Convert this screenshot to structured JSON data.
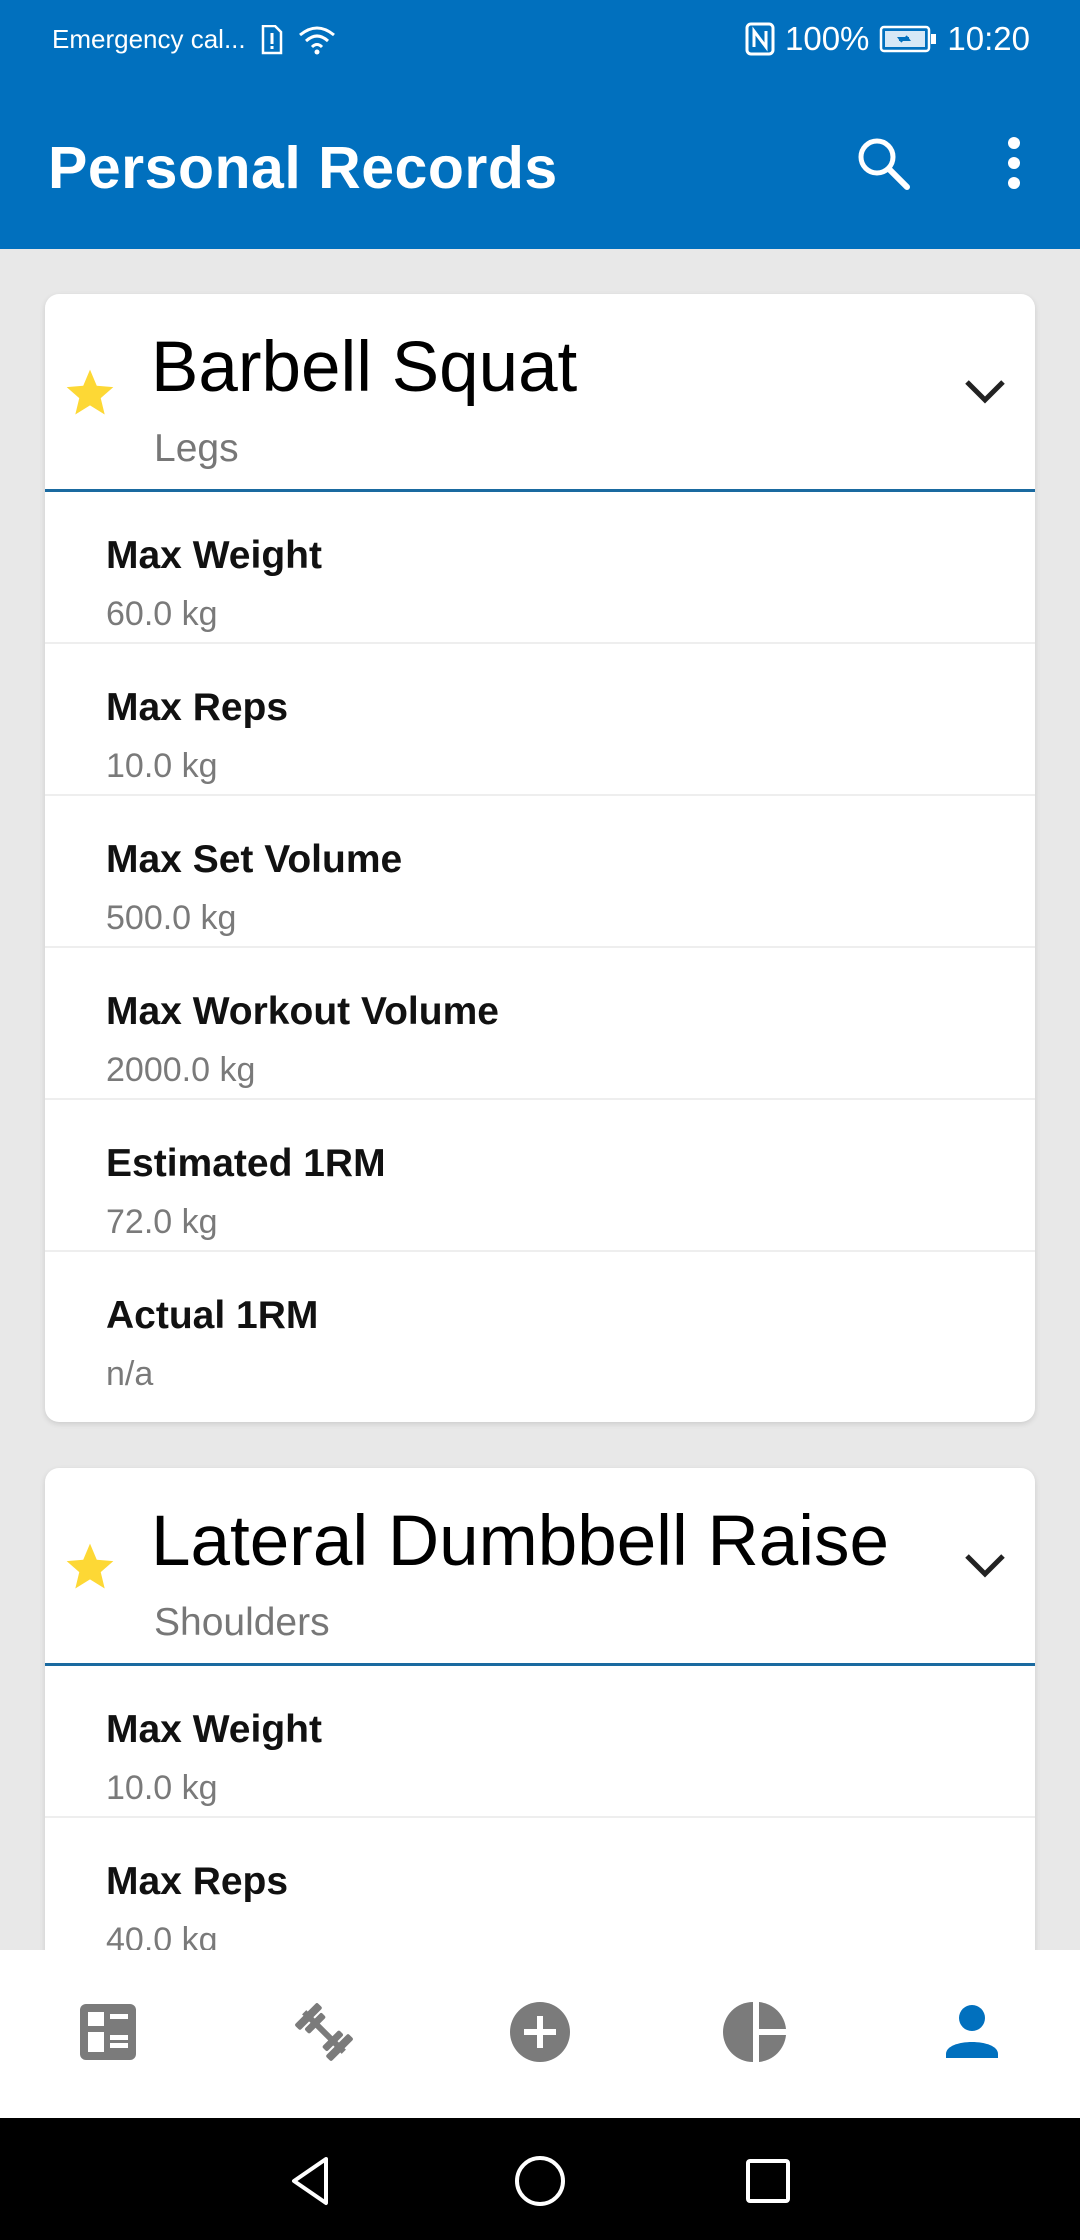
{
  "status_bar": {
    "carrier": "Emergency cal...",
    "battery": "100%",
    "time": "10:20"
  },
  "app_bar": {
    "title": "Personal Records"
  },
  "colors": {
    "primary": "#0170be",
    "star": "#fdd835",
    "nav_icon": "#7b7b7b",
    "nav_active": "#0170be"
  },
  "exercises": [
    {
      "name": "Barbell Squat",
      "category": "Legs",
      "records": [
        {
          "label": "Max Weight",
          "value": "60.0 kg"
        },
        {
          "label": "Max Reps",
          "value": "10.0 kg"
        },
        {
          "label": "Max Set Volume",
          "value": "500.0 kg"
        },
        {
          "label": "Max Workout Volume",
          "value": "2000.0 kg"
        },
        {
          "label": "Estimated 1RM",
          "value": "72.0 kg"
        },
        {
          "label": "Actual 1RM",
          "value": "n/a"
        }
      ]
    },
    {
      "name": "Lateral Dumbbell Raise",
      "category": "Shoulders",
      "records": [
        {
          "label": "Max Weight",
          "value": "10.0 kg"
        },
        {
          "label": "Max Reps",
          "value": "40.0 kg"
        }
      ]
    }
  ],
  "bottom_nav": [
    {
      "icon": "dashboard-icon",
      "active": false
    },
    {
      "icon": "dumbbell-icon",
      "active": false
    },
    {
      "icon": "add-circle-icon",
      "active": false
    },
    {
      "icon": "pie-chart-icon",
      "active": false
    },
    {
      "icon": "person-icon",
      "active": true
    }
  ]
}
